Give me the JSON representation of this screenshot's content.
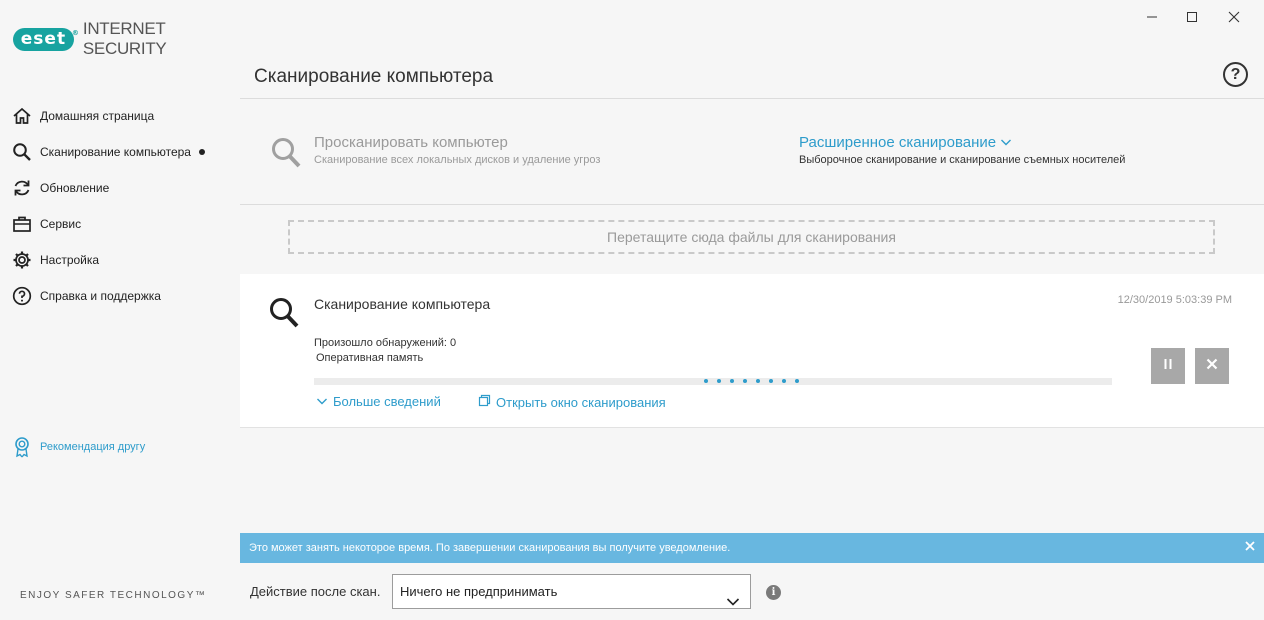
{
  "app": {
    "logo_text": "eset",
    "logo_reg": "®",
    "product_name": "INTERNET SECURITY",
    "tagline": "ENJOY SAFER TECHNOLOGY™"
  },
  "window_controls": {
    "minimize": "minimize-icon",
    "maximize": "maximize-icon",
    "close": "close-icon"
  },
  "sidebar": {
    "items": [
      {
        "label": "Домашняя страница",
        "icon": "home-icon"
      },
      {
        "label": "Сканирование компьютера",
        "icon": "search-icon",
        "active": true
      },
      {
        "label": "Обновление",
        "icon": "refresh-icon"
      },
      {
        "label": "Сервис",
        "icon": "briefcase-icon"
      },
      {
        "label": "Настройка",
        "icon": "gear-icon"
      },
      {
        "label": "Справка и поддержка",
        "icon": "help-circle-icon"
      }
    ],
    "refer": {
      "label": "Рекомендация другу",
      "icon": "award-icon"
    }
  },
  "header": {
    "title": "Сканирование компьютера",
    "help": "?"
  },
  "options": {
    "scan": {
      "title": "Просканировать компьютер",
      "subtitle": "Сканирование всех локальных дисков и удаление угроз"
    },
    "advanced": {
      "title": "Расширенное сканирование",
      "subtitle": "Выборочное сканирование и сканирование съемных носителей"
    }
  },
  "dropzone": {
    "label": "Перетащите сюда файлы для сканирования"
  },
  "scan_panel": {
    "title": "Сканирование компьютера",
    "timestamp": "12/30/2019 5:03:39 PM",
    "detections": "Произошло обнаружений: 0",
    "target": "Оперативная память",
    "more_details": "Больше сведений",
    "open_window": "Открыть окно сканирования",
    "pause": "pause-icon",
    "stop": "close-icon"
  },
  "notice": {
    "text": "Это может занять некоторое время. По завершении сканирования вы получите уведомление."
  },
  "after_scan": {
    "label": "Действие после скан.",
    "selected": "Ничего не предпринимать",
    "info": "i"
  },
  "colors": {
    "brand": "#17a3a0",
    "accent": "#2e9ccb",
    "notice_bg": "#68b7e0"
  }
}
